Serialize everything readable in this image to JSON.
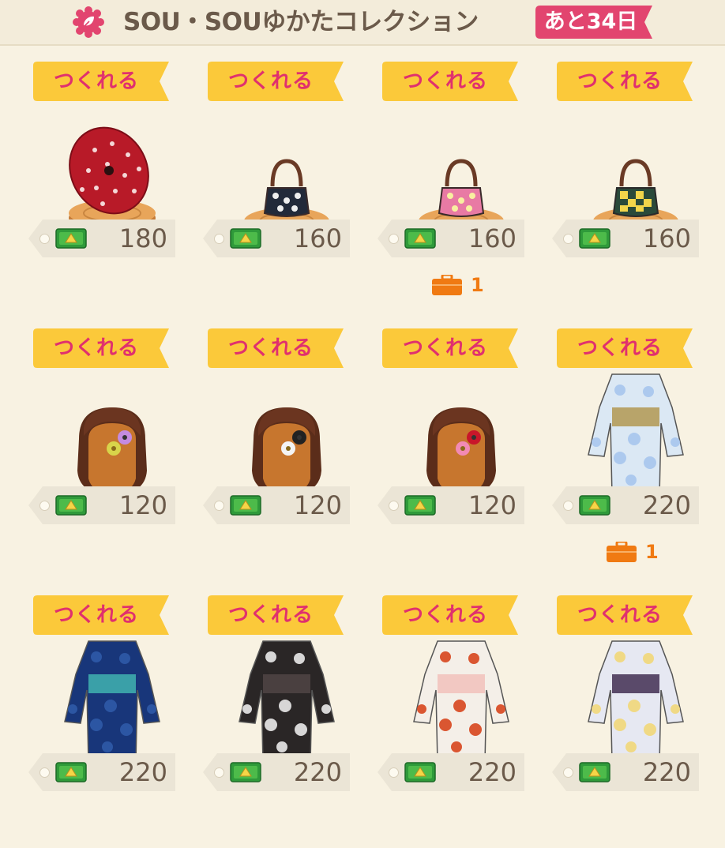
{
  "header": {
    "title": "SOU・SOUゆかたコレクション",
    "days_left": "あと34日",
    "accent_color": "#e2456f"
  },
  "ribbon_label": "つくれる",
  "items": [
    {
      "name": "red-umbrella",
      "price": "180",
      "owned": ""
    },
    {
      "name": "black-bag",
      "price": "160",
      "owned": ""
    },
    {
      "name": "pink-bag",
      "price": "160",
      "owned": "1"
    },
    {
      "name": "check-bag",
      "price": "160",
      "owned": ""
    },
    {
      "name": "hair-flower-yellow",
      "price": "120",
      "owned": ""
    },
    {
      "name": "hair-flower-white",
      "price": "120",
      "owned": ""
    },
    {
      "name": "hair-flower-pink",
      "price": "120",
      "owned": ""
    },
    {
      "name": "yukata-light-blue",
      "price": "220",
      "owned": "1"
    },
    {
      "name": "yukata-navy",
      "price": "220",
      "owned": ""
    },
    {
      "name": "yukata-black",
      "price": "220",
      "owned": ""
    },
    {
      "name": "yukata-orange",
      "price": "220",
      "owned": ""
    },
    {
      "name": "yukata-lavender",
      "price": "220",
      "owned": ""
    }
  ]
}
